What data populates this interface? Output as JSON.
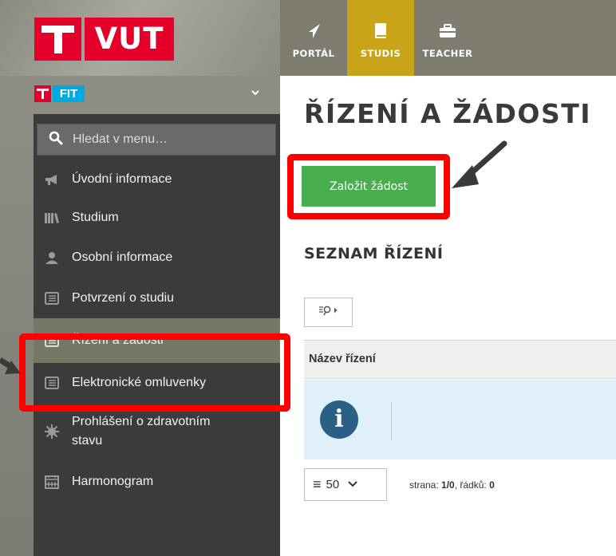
{
  "brand": {
    "vut_text": "VUT",
    "fit_text": "FIT"
  },
  "topnav": [
    {
      "label": "PORTÁL",
      "icon": "paper-plane-icon",
      "active": false
    },
    {
      "label": "STUDIS",
      "icon": "book-icon",
      "active": true
    },
    {
      "label": "TEACHER",
      "icon": "briefcase-icon",
      "active": false
    }
  ],
  "sidebar": {
    "search_placeholder": "Hledat v menu…",
    "items": [
      {
        "label": "Úvodní informace",
        "icon": "megaphone-icon"
      },
      {
        "label": "Studium",
        "icon": "books-icon"
      },
      {
        "label": "Osobní informace",
        "icon": "person-icon"
      },
      {
        "label": "Potvrzení o studiu",
        "icon": "document-icon"
      },
      {
        "label": "Řízení a žádosti",
        "icon": "document-icon",
        "active": true
      },
      {
        "label": "Elektronické omluvenky",
        "icon": "document-icon"
      },
      {
        "label": "Prohlášení o zdravotním",
        "label2": "stavu",
        "icon": "virus-icon"
      },
      {
        "label": "Harmonogram",
        "icon": "calendar-icon"
      }
    ]
  },
  "main": {
    "title": "ŘÍZENÍ A ŽÁDOSTI",
    "create_button": "Založit žádost",
    "section_title": "SEZNAM ŘÍZENÍ",
    "table_header": "Název řízení",
    "info_icon_glyph": "i",
    "page_size": "50",
    "pager": {
      "page_label": "strana:",
      "page_value": "1/0",
      "rows_label": "řádků:",
      "rows_value": "0"
    }
  },
  "colors": {
    "vut_red": "#e4002b",
    "fit_blue": "#00a9e0",
    "active_tab": "#c9a418",
    "create_button": "#4aae4f",
    "highlight": "#ff0000"
  }
}
